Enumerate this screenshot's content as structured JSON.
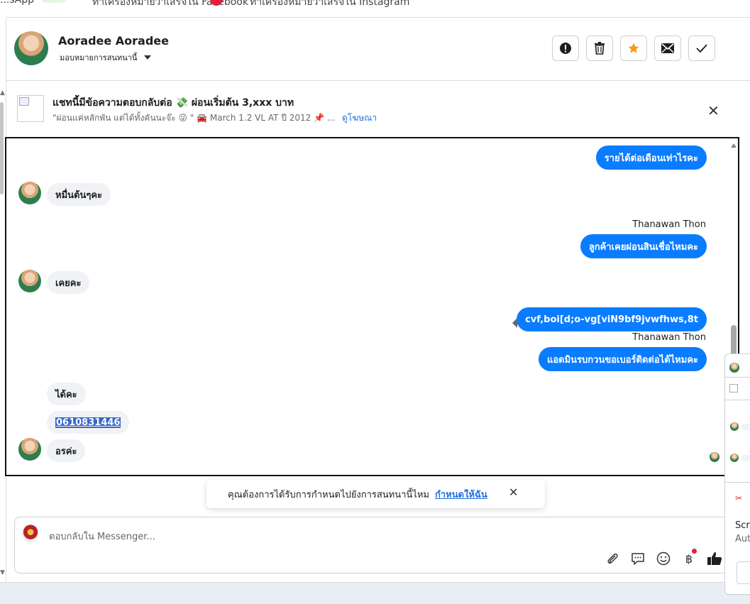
{
  "top_tabs": [
    {
      "label": "...sApp"
    },
    {
      "label": "ทำเครื่องหมายว่าเสร็จใน Facebook"
    },
    {
      "label": "ทำเครื่องหมายว่าเสร็จใน Instagram"
    }
  ],
  "header": {
    "name": "Aoradee Aoradee",
    "assign_label": "มอบหมายการสนทนานี้",
    "actions": [
      {
        "icon": "alert-icon",
        "name": "spam-button"
      },
      {
        "icon": "trash-icon",
        "name": "delete-button"
      },
      {
        "icon": "star-icon",
        "name": "star-button",
        "color": "#f39c12"
      },
      {
        "icon": "envelope-icon",
        "name": "mark-unread-button"
      },
      {
        "icon": "check-icon",
        "name": "mark-done-button"
      }
    ]
  },
  "ad": {
    "title": "แชทนี้มีข้อความตอบกลับต่อ 💸 ผ่อนเริ่มต้น 3,xxx บาท",
    "subtitle": "\"ผ่อนแค่หลักพัน แต่ได้ทั้งคันนะจ๊ะ 😜 \" 🚘 March 1.2 VL AT ปี 2012 📌 ...",
    "link": "ดูโฆษณา"
  },
  "messages": [
    {
      "dir": "out",
      "text": "รายได้ต่อเดือนเท่าไรคะ"
    },
    {
      "dir": "in",
      "text": "หมื่นต้นๆคะ"
    },
    {
      "dir": "out",
      "sender": "Thanawan Thon",
      "text": "ลูกค้าเคยผ่อนสินเชื่อไหมคะ"
    },
    {
      "dir": "in",
      "text": "เคยคะ"
    },
    {
      "dir": "out",
      "text": "cvf,boi[d;o-vg[viN9bf9jvwfhws,8t"
    },
    {
      "dir": "out",
      "sender": "Thanawan Thon",
      "text": "แอดมินรบกวนขอเบอร์ติดต่อได้ไหมคะ"
    },
    {
      "dir": "in",
      "text": "ได้คะ"
    },
    {
      "dir": "in",
      "text": "0610831446",
      "selected": true
    },
    {
      "dir": "in",
      "text": "อรค่ะ"
    }
  ],
  "toast": {
    "text": "คุณต้องการได้รับการกำหนดไปยังการสนทนานี้ไหม",
    "link": "กำหนดให้ฉัน"
  },
  "composer": {
    "placeholder": "ตอบกลับใน Messenger...",
    "tools": [
      "paperclip-icon",
      "saved-reply-icon",
      "emoji-icon",
      "baht-icon",
      "like-icon"
    ],
    "baht_symbol": "฿"
  },
  "side_panel": {
    "line1": "Scre",
    "line2": "Aut"
  },
  "colors": {
    "accent": "#0a7cff",
    "link": "#216fdb"
  }
}
